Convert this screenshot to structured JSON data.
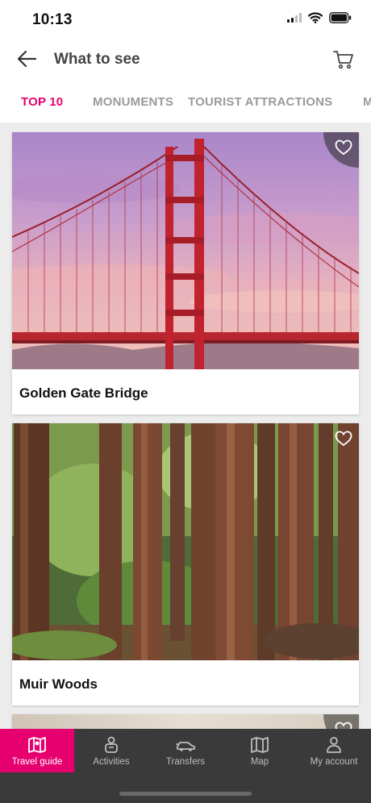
{
  "status": {
    "time": "10:13"
  },
  "header": {
    "title": "What to see",
    "back_icon": "arrow-left-icon",
    "cart_icon": "cart-icon"
  },
  "tabs": [
    {
      "label": "TOP 10",
      "active": true
    },
    {
      "label": "MONUMENTS",
      "active": false
    },
    {
      "label": "TOURIST ATTRACTIONS",
      "active": false
    },
    {
      "label": "M",
      "active": false
    }
  ],
  "cards": [
    {
      "title": "Golden Gate Bridge",
      "image": "golden-gate-bridge-photo",
      "favorite_icon": "heart-icon"
    },
    {
      "title": "Muir Woods",
      "image": "redwood-forest-photo",
      "favorite_icon": "heart-icon"
    },
    {
      "title": "",
      "image": "partial-photo",
      "favorite_icon": "heart-icon"
    }
  ],
  "nav": [
    {
      "label": "Travel guide",
      "icon": "map-book-icon",
      "active": true
    },
    {
      "label": "Activities",
      "icon": "person-bag-icon",
      "active": false
    },
    {
      "label": "Transfers",
      "icon": "car-icon",
      "active": false
    },
    {
      "label": "Map",
      "icon": "map-icon",
      "active": false
    },
    {
      "label": "My account",
      "icon": "user-icon",
      "active": false
    }
  ],
  "colors": {
    "accent": "#e6006f",
    "nav_bg": "#3a3a3a",
    "inactive_tab": "#9a9a9a"
  }
}
